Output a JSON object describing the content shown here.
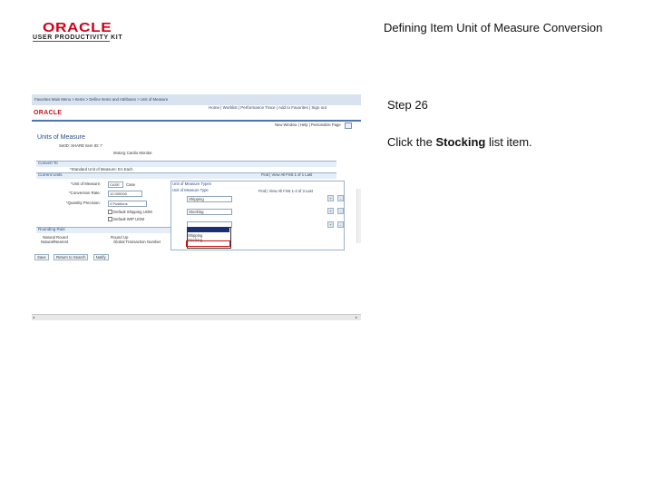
{
  "logo": {
    "word": "ORACLE",
    "sub": "USER PRODUCTIVITY KIT"
  },
  "document_title": "Defining Item Unit of Measure Conversion",
  "step": "Step 26",
  "instruction": {
    "prefix": "Click the ",
    "bold": "Stocking",
    "suffix": " list item."
  },
  "screenshot": {
    "nav_line": "Favorites    Main Menu    >  Items  >  Define Items and Attributes  >  Unit of Measure",
    "logo": "ORACLE",
    "header_links": "Home  |  Worklist  |  Performance Trace  |  Add to Favorites  |  Sign out",
    "new_window": "New Window  |  Help  |  Personalize Page",
    "page_title": "Units of Measure",
    "head_row1": "SetID:  SHARE      Item ID:  7",
    "head_row2": "Motorg Cardio Monitor",
    "convert_to": "Convert To",
    "convert_row": "*Standard Unit of Measure:  EA     Each",
    "current_units": "Current Units",
    "current_links": "Find  |  View All      First  1 of 1  Last",
    "uom_label": "*Unit of Measure:",
    "uom_value": "CASE",
    "uom_desc": "Case",
    "conv_rate_label": "*Conversion Rate:",
    "conv_rate_value": "12.000000",
    "qty_prec_label": "*Quantity Precision:",
    "qty_prec_value": "4 Positions",
    "chk1": "Default Shipping UOM",
    "chk2": "Default WIP UOM",
    "uom_types_title": "Unit of Measure Types",
    "uom_types_sub": "Unit of Measure Type",
    "uom_types_links": "Find  |  View All      First  1-3 of 3  Last",
    "type1": "Shipping",
    "type2": "Stocking",
    "rounding_title": "Rounding Rule",
    "round1": "Natural Round",
    "round1b": "Natural/Nearest",
    "round2": "Round Up",
    "round2b": "Global Transaction Number",
    "dd_opt1": "Shipping",
    "dd_opt2": "Stocking",
    "dd_opt3": "",
    "actions": [
      "Save",
      "Return to Search",
      "Notify"
    ],
    "pm_plus": "+",
    "pm_minus": "-",
    "scroll_left": "◂",
    "scroll_right": "▸"
  }
}
